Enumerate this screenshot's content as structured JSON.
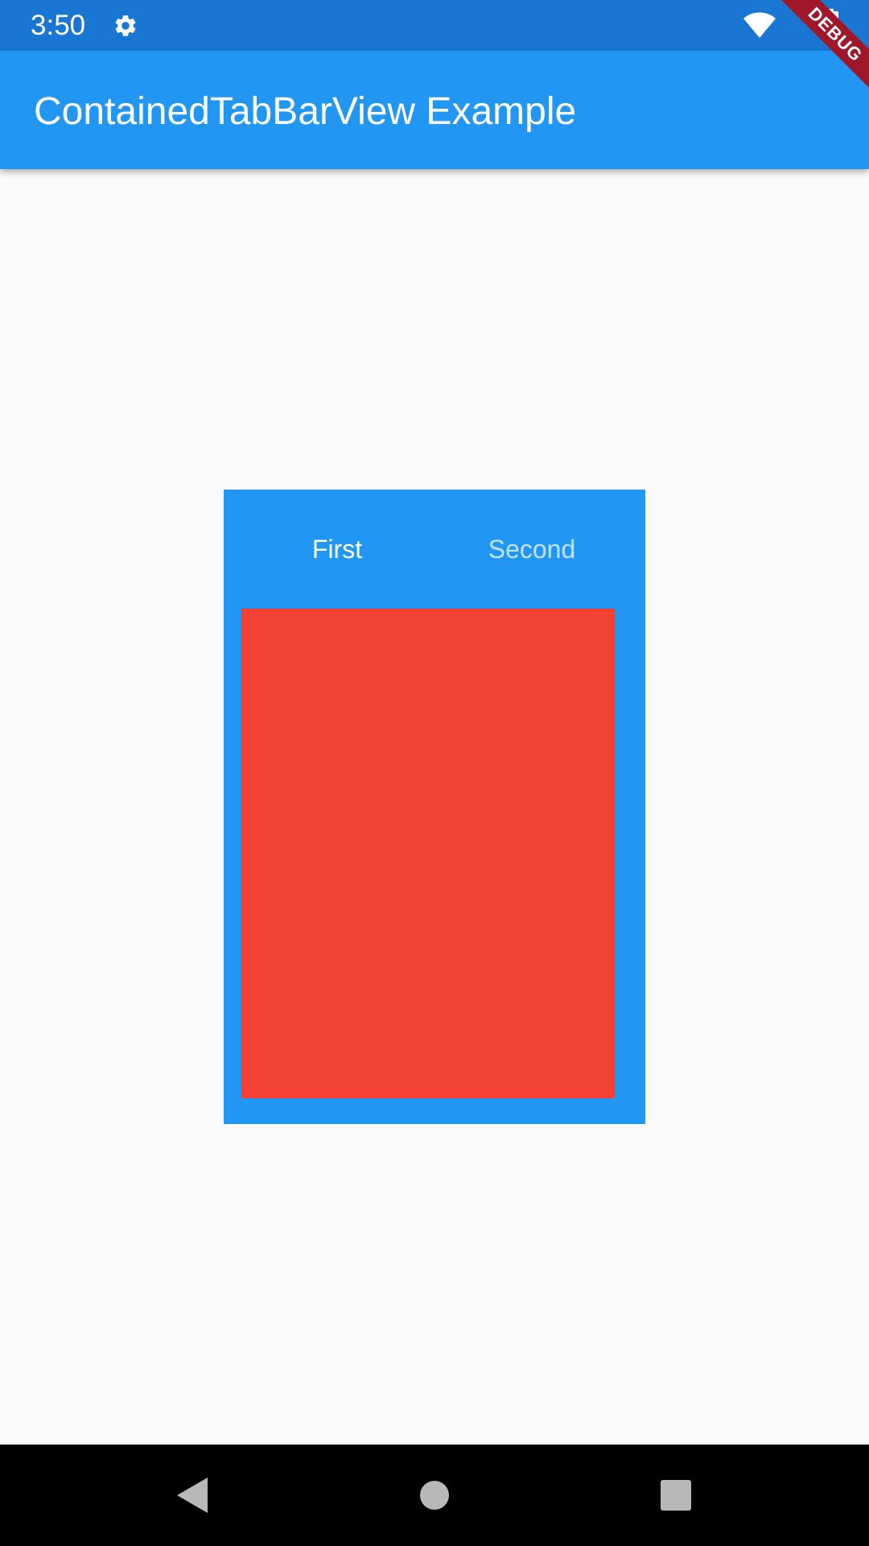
{
  "status_bar": {
    "time": "3:50",
    "icons": [
      "gear-icon",
      "wifi-icon",
      "battery-icon"
    ]
  },
  "app_bar": {
    "title": "ContainedTabBarView Example"
  },
  "debug_banner": {
    "label": "DEBUG"
  },
  "tabs": [
    {
      "label": "First",
      "selected": true
    },
    {
      "label": "Second",
      "selected": false
    }
  ],
  "tab_view": {
    "color": "#f44336"
  },
  "colors": {
    "primary": "#2196f3",
    "primary_dark": "#1976d2",
    "tab_view_red": "#f44336",
    "background": "#fafafa"
  },
  "nav_bar": {
    "buttons": [
      "back-icon",
      "home-icon",
      "recents-icon"
    ]
  }
}
